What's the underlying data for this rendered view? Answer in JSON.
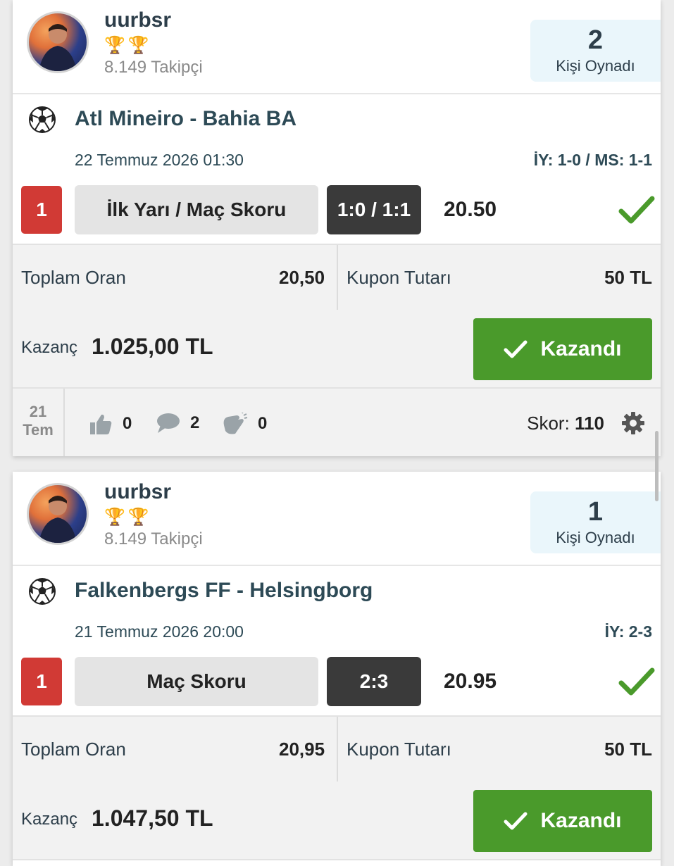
{
  "cards": [
    {
      "user": {
        "name": "uurbsr",
        "trophies": "🏆🏆",
        "followers": "8.149 Takipçi"
      },
      "played": {
        "count": "2",
        "label": "Kişi Oynadı"
      },
      "match": {
        "title": "Atl Mineiro - Bahia BA",
        "date": "22 Temmuz 2026 01:30",
        "result": "İY: 1-0 / MS: 1-1",
        "pick_no": "1",
        "bet_type": "İlk Yarı / Maç Skoru",
        "bet_value": "1:0 / 1:1",
        "odds": "20.50",
        "icon": "soccer-ball-icon"
      },
      "summary": {
        "total_odds_label": "Toplam Oran",
        "total_odds": "20,50",
        "stake_label": "Kupon Tutarı",
        "stake": "50 TL"
      },
      "win": {
        "label": "Kazanç",
        "amount": "1.025,00 TL",
        "button": "Kazandı"
      },
      "footer": {
        "day": "21",
        "month": "Tem",
        "likes": "0",
        "comments": "2",
        "claps": "0",
        "score_label": "Skor:",
        "score": "110"
      }
    },
    {
      "user": {
        "name": "uurbsr",
        "trophies": "🏆🏆",
        "followers": "8.149 Takipçi"
      },
      "played": {
        "count": "1",
        "label": "Kişi Oynadı"
      },
      "match": {
        "title": "Falkenbergs FF - Helsingborg",
        "date": "21 Temmuz 2026 20:00",
        "result": "İY: 2-3",
        "pick_no": "1",
        "bet_type": "Maç Skoru",
        "bet_value": "2:3",
        "odds": "20.95",
        "icon": "soccer-ball-icon"
      },
      "summary": {
        "total_odds_label": "Toplam Oran",
        "total_odds": "20,95",
        "stake_label": "Kupon Tutarı",
        "stake": "50 TL"
      },
      "win": {
        "label": "Kazanç",
        "amount": "1.047,50 TL",
        "button": "Kazandı"
      }
    }
  ],
  "colors": {
    "win_green": "#4a9a2b",
    "pick_red": "#d13a35",
    "text_dark": "#2d4a56",
    "played_bg": "#eaf6fb"
  }
}
